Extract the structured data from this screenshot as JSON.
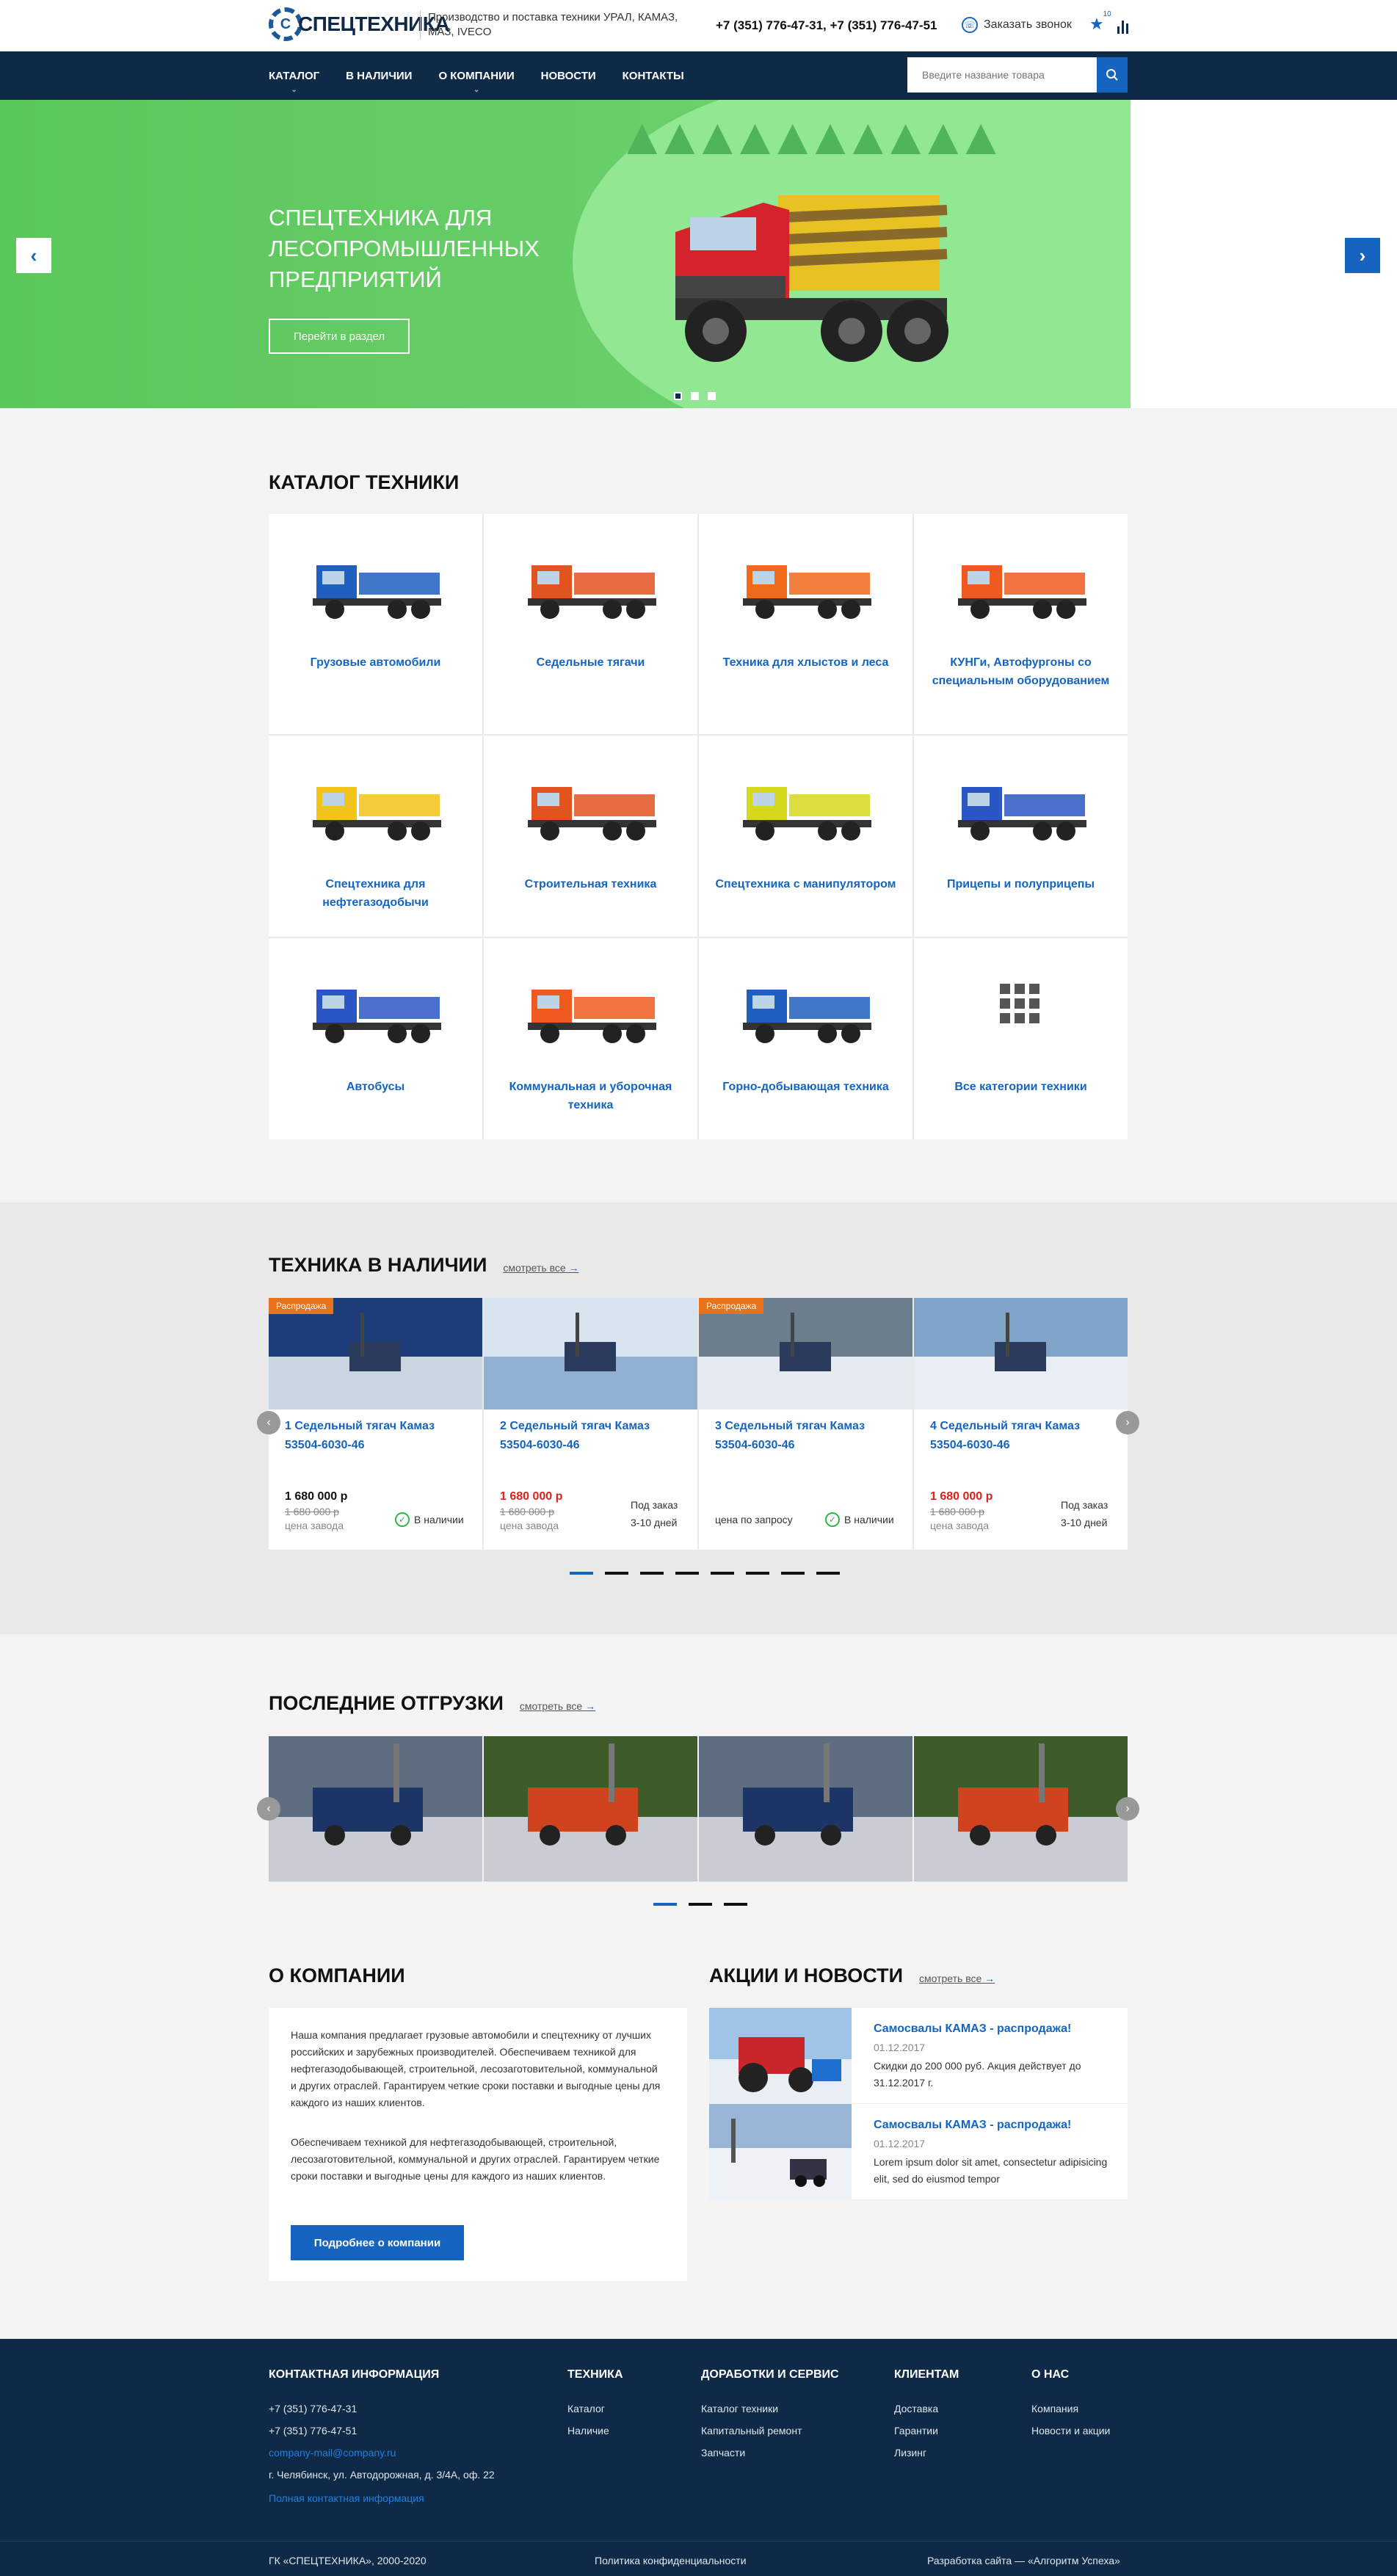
{
  "header": {
    "logo_text": "СПЕЦТЕХНИКА",
    "tagline": "Производство и поставка техники УРАЛ, КАМАЗ, МАЗ, IVECO",
    "phones": "+7 (351) 776-47-31, +7 (351) 776-47-51",
    "callback_label": "Заказать звонок",
    "favorites_count": "10"
  },
  "nav": {
    "items": [
      {
        "label": "КАТАЛОГ"
      },
      {
        "label": "В НАЛИЧИИ"
      },
      {
        "label": "О КОМПАНИИ"
      },
      {
        "label": "НОВОСТИ"
      },
      {
        "label": "КОНТАКТЫ"
      }
    ],
    "search_placeholder": "Введите название товара"
  },
  "hero": {
    "title": "СПЕЦТЕХНИКА ДЛЯ ЛЕСОПРОМЫШЛЕННЫХ ПРЕДПРИЯТИЙ",
    "button": "Перейти в раздел",
    "slides": 3,
    "active_slide": 1
  },
  "catalog": {
    "title": "КАТАЛОГ ТЕХНИКИ",
    "items": [
      {
        "label": "Грузовые автомобили",
        "color": "#1f5fbf"
      },
      {
        "label": "Седельные тягачи",
        "color": "#e2541f"
      },
      {
        "label": "Техника для хлыстов и леса",
        "color": "#f06a1a"
      },
      {
        "label": "КУНГи, Автофургоны со специальным оборудованием",
        "color": "#ef5a20"
      },
      {
        "label": "Спецтехника для нефтегазодобычи",
        "color": "#f2c318"
      },
      {
        "label": "Строительная техника",
        "color": "#e2541f"
      },
      {
        "label": "Спецтехника с манипулятором",
        "color": "#d6d81e"
      },
      {
        "label": "Прицепы и полуприцепы",
        "color": "#2a56c6"
      },
      {
        "label": "Автобусы",
        "color": "#2a56c6"
      },
      {
        "label": "Коммунальная и уборочная техника",
        "color": "#ef5a20"
      },
      {
        "label": "Горно-добывающая техника",
        "color": "#1f5fbf"
      },
      {
        "label": "Все категории техники",
        "color": "#555555"
      }
    ]
  },
  "stock": {
    "title": "ТЕХНИКА В НАЛИЧИИ",
    "more": "смотреть все",
    "products": [
      {
        "badge": "Распродажа",
        "name": "1 Седельный тягач Камаз 53504-6030-46",
        "price": "1 680 000 р",
        "old_price": "1 680 000 р",
        "factory": "цена завода",
        "status": "В наличии",
        "red": false
      },
      {
        "badge": "",
        "name": "2 Седельный тягач Камаз 53504-6030-46",
        "price": "1 680 000 р",
        "old_price": "1 680 000 р",
        "factory": "цена завода",
        "status": "Под заказ",
        "status2": "3-10 дней",
        "red": true
      },
      {
        "badge": "Распродажа",
        "name": "3 Седельный тягач Камаз 53504-6030-46",
        "price": "",
        "request": "цена по запросу",
        "status": "В наличии",
        "red": false
      },
      {
        "badge": "",
        "name": "4 Седельный тягач Камаз 53504-6030-46",
        "price": "1 680 000 р",
        "old_price": "1 680 000 р",
        "factory": "цена завода",
        "status": "Под заказ",
        "status2": "3-10 дней",
        "red": true
      }
    ],
    "pages": 8
  },
  "shipments": {
    "title": "ПОСЛЕДНИЕ ОТГРУЗКИ",
    "more": "смотреть все",
    "pages": 3
  },
  "about": {
    "title": "О КОМПАНИИ",
    "p1": "Наша компания предлагает грузовые автомобили и спецтехнику от лучших российских и зарубежных производителей. Обеспечиваем техникой для нефтегазодобывающей, строительной, лесозаготовительной, коммунальной и других отраслей. Гарантируем четкие сроки поставки и выгодные цены для каждого из наших клиентов.",
    "p2": "Обеспечиваем техникой для нефтегазодобывающей, строительной, лесозаготовительной, коммунальной и других отраслей. Гарантируем четкие сроки поставки и выгодные цены для каждого из наших клиентов.",
    "button": "Подробнее о компании"
  },
  "news": {
    "title": "АКЦИИ И НОВОСТИ",
    "more": "смотреть все",
    "items": [
      {
        "title": "Самосвалы КАМАЗ - распродажа!",
        "date": "01.12.2017",
        "text": "Скидки до 200 000 руб. Акция действует до 31.12.2017 г."
      },
      {
        "title": "Самосвалы КАМАЗ - распродажа!",
        "date": "01.12.2017",
        "text": "Lorem ipsum dolor sit amet, consectetur adipisicing elit, sed do eiusmod tempor"
      }
    ]
  },
  "footer": {
    "contacts": {
      "title": "КОНТАКТНАЯ ИНФОРМАЦИЯ",
      "phone1": "+7 (351) 776-47-31",
      "phone2": "+7 (351) 776-47-51",
      "email": "company-mail@company.ru",
      "address": "г. Челябинск, ул. Автодорожная, д. 3/4А, оф. 22",
      "full_link": "Полная контактная информация"
    },
    "tech": {
      "title": "ТЕХНИКА",
      "links": [
        "Каталог",
        "Наличие"
      ]
    },
    "service": {
      "title": "ДОРАБОТКИ И СЕРВИС",
      "links": [
        "Каталог техники",
        "Капитальный ремонт",
        "Запчасти"
      ]
    },
    "clients": {
      "title": "КЛИЕНТАМ",
      "links": [
        "Доставка",
        "Гарантии",
        "Лизинг"
      ]
    },
    "about": {
      "title": "О НАС",
      "links": [
        "Компания",
        "Новости и акции"
      ]
    },
    "copyright": "ГК «СПЕЦТЕХНИКА», 2000-2020",
    "privacy": "Политика конфиденциальности",
    "developer": "Разработка сайта — «Алгоритм Успеха»"
  }
}
